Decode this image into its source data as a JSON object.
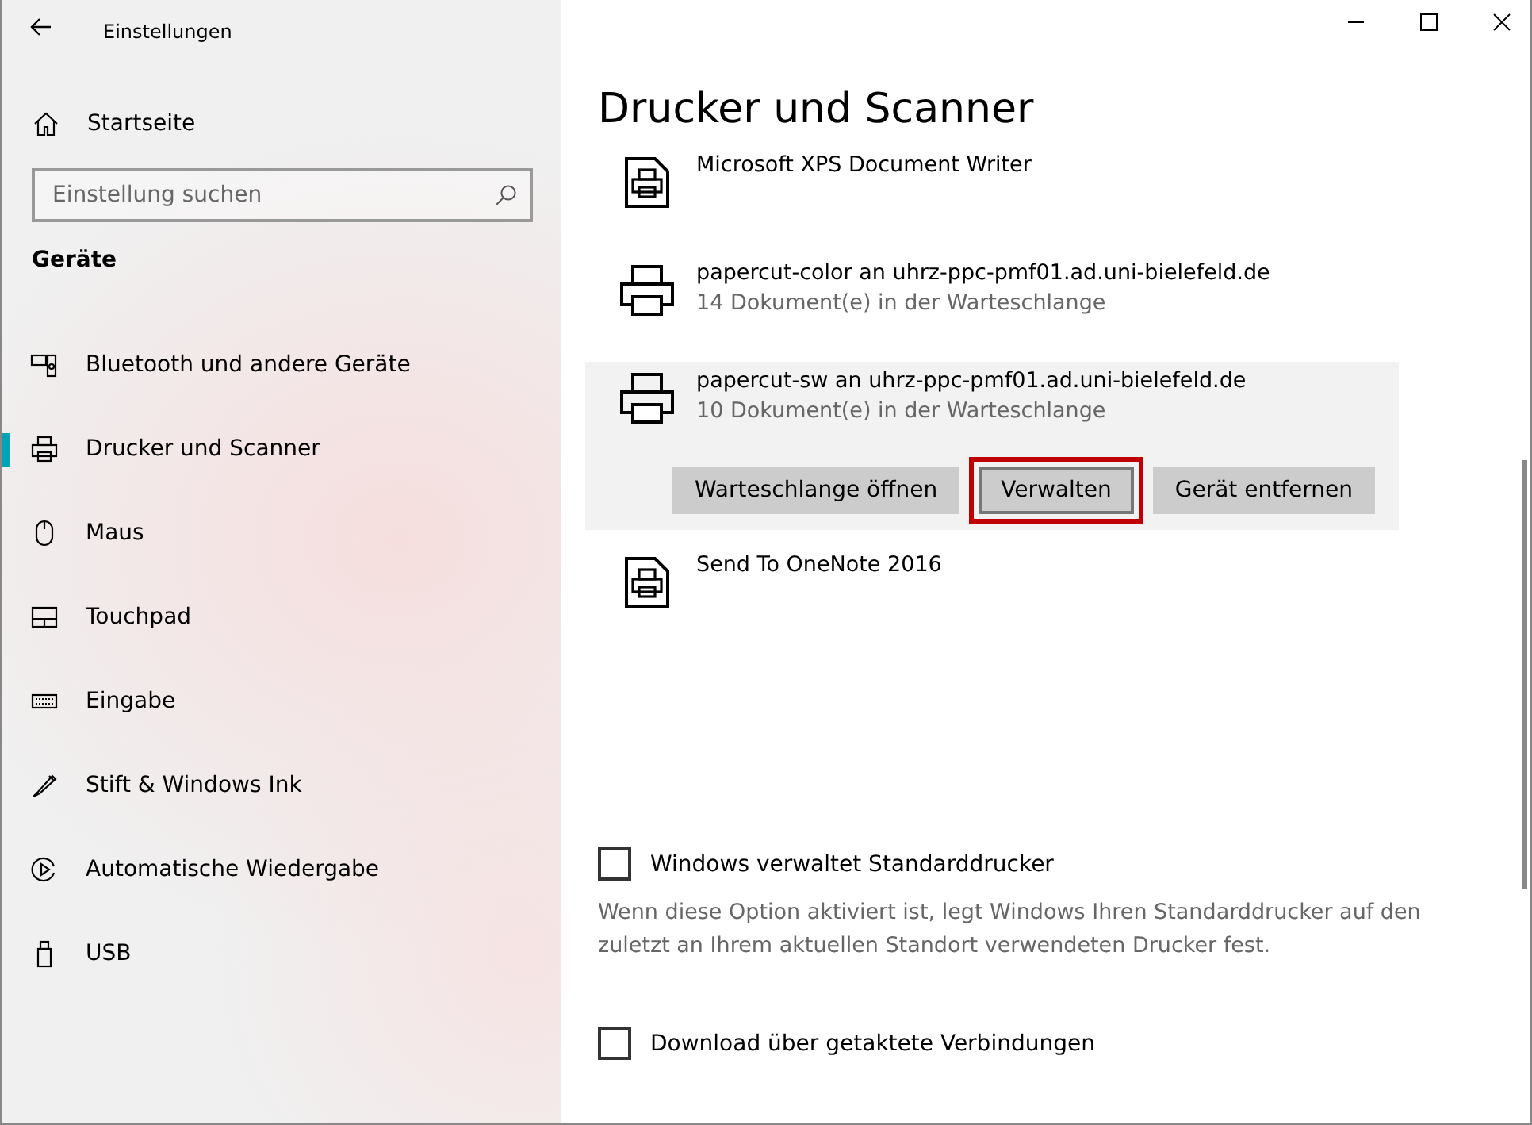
{
  "window": {
    "title": "Einstellungen"
  },
  "sidebar": {
    "home": {
      "label": "Startseite"
    },
    "search": {
      "placeholder": "Einstellung suchen"
    },
    "section": "Geräte",
    "items": [
      {
        "label": "Bluetooth und andere Geräte",
        "kind": "bluetooth",
        "selected": false
      },
      {
        "label": "Drucker und Scanner",
        "kind": "printer",
        "selected": true
      },
      {
        "label": "Maus",
        "kind": "mouse",
        "selected": false
      },
      {
        "label": "Touchpad",
        "kind": "touchpad",
        "selected": false
      },
      {
        "label": "Eingabe",
        "kind": "keyboard",
        "selected": false
      },
      {
        "label": "Stift & Windows Ink",
        "kind": "pen",
        "selected": false
      },
      {
        "label": "Automatische Wiedergabe",
        "kind": "autoplay",
        "selected": false
      },
      {
        "label": "USB",
        "kind": "usb",
        "selected": false
      }
    ]
  },
  "main": {
    "heading": "Drucker und Scanner",
    "printers": [
      {
        "name": "Microsoft XPS Document Writer",
        "kind": "document",
        "expanded": false
      },
      {
        "name": "papercut-color an uhrz-ppc-pmf01.ad.uni-bielefeld.de",
        "status": "14 Dokument(e) in der Warteschlange",
        "kind": "printer",
        "expanded": false
      },
      {
        "name": "papercut-sw an uhrz-ppc-pmf01.ad.uni-bielefeld.de",
        "status": "10 Dokument(e) in der Warteschlange",
        "kind": "printer",
        "expanded": true,
        "actions": [
          {
            "label": "Warteschlange öffnen",
            "highlighted": false
          },
          {
            "label": "Verwalten",
            "highlighted": true
          },
          {
            "label": "Gerät entfernen",
            "highlighted": false
          }
        ]
      },
      {
        "name": "Send To OneNote 2016",
        "kind": "document",
        "expanded": false
      }
    ],
    "options": [
      {
        "label": "Windows verwaltet Standarddrucker",
        "checked": false,
        "description": "Wenn diese Option aktiviert ist, legt Windows Ihren Standarddrucker auf den zuletzt an Ihrem aktuellen Standort verwendeten Drucker fest."
      },
      {
        "label": "Download über getaktete Verbindungen",
        "checked": false
      }
    ]
  }
}
